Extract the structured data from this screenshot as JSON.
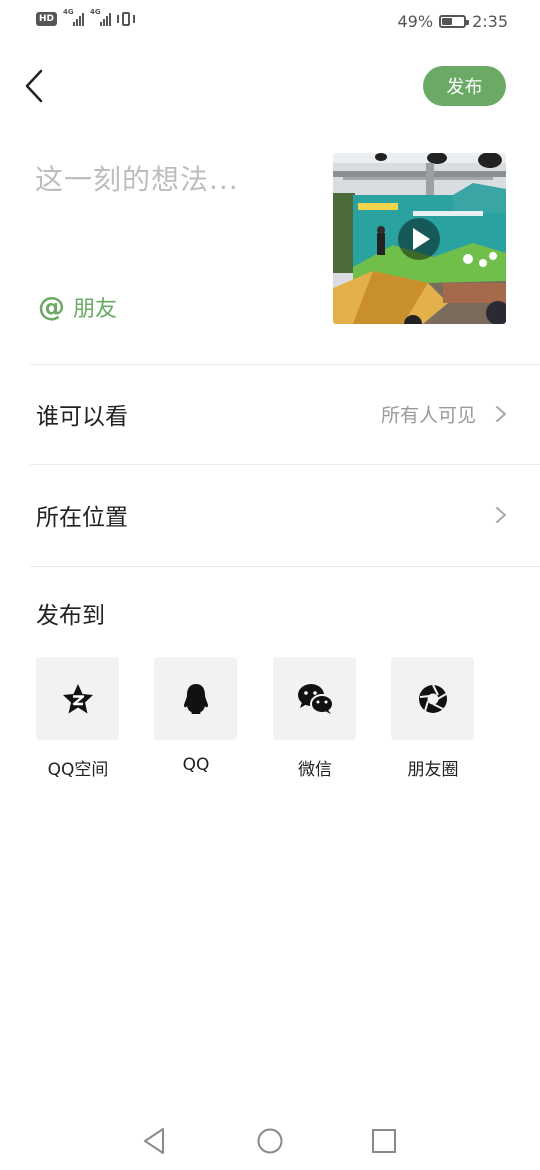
{
  "status_bar": {
    "hd": "HD",
    "network_1": "4G",
    "network_2": "4G",
    "battery_percent": "49%",
    "battery_level": 0.49,
    "time": "2:35"
  },
  "header": {
    "back_icon": "chevron-left-icon",
    "publish_label": "发布",
    "accent_color": "#6aaa64"
  },
  "composer": {
    "placeholder": "这一刻的想法...",
    "mention_symbol": "@",
    "mention_label": "朋友",
    "video_thumbnail": {
      "kind": "video",
      "play_icon": "play-icon"
    }
  },
  "settings": [
    {
      "label": "谁可以看",
      "value": "所有人可见"
    },
    {
      "label": "所在位置",
      "value": ""
    }
  ],
  "share": {
    "title": "发布到",
    "targets": [
      {
        "label": "QQ空间",
        "icon": "qzone-star-icon"
      },
      {
        "label": "QQ",
        "icon": "qq-penguin-icon"
      },
      {
        "label": "微信",
        "icon": "wechat-icon"
      },
      {
        "label": "朋友圈",
        "icon": "moments-aperture-icon"
      }
    ]
  },
  "nav_bar": {
    "back": "triangle-back-icon",
    "home": "circle-home-icon",
    "recents": "square-recents-icon"
  }
}
